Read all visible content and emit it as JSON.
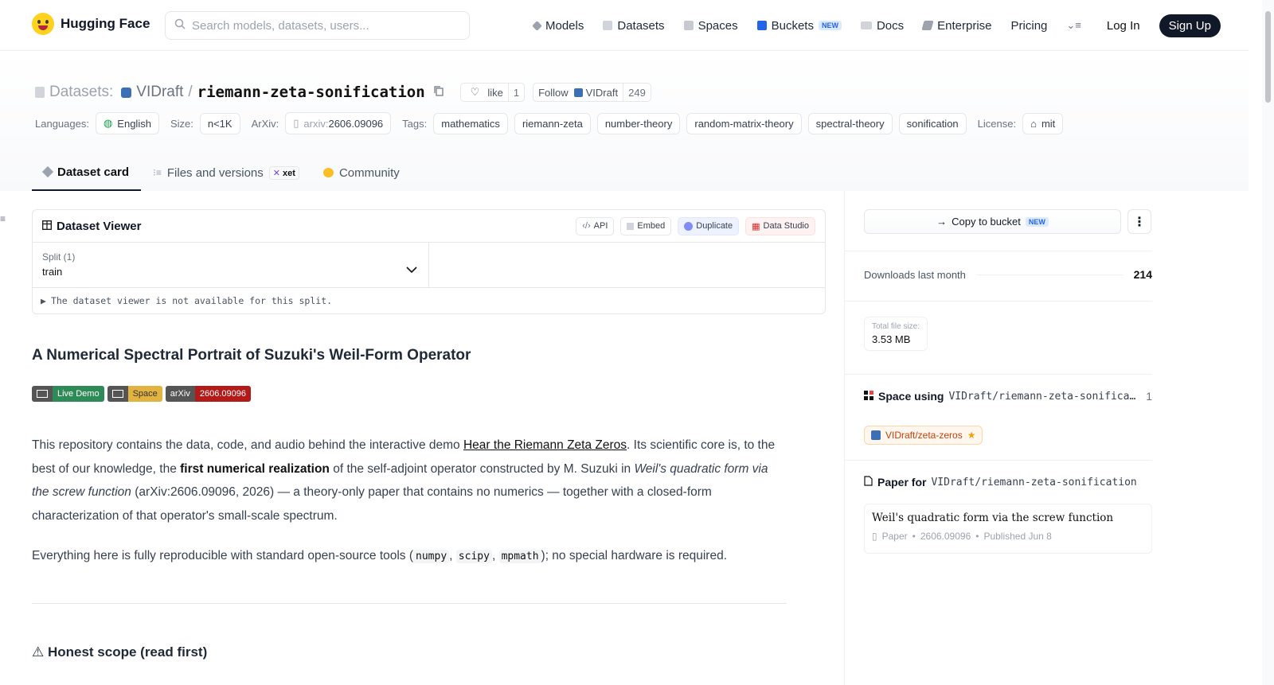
{
  "nav": {
    "brand": "Hugging Face",
    "search_placeholder": "Search models, datasets, users...",
    "links": [
      "Models",
      "Datasets",
      "Spaces",
      "Buckets",
      "Docs",
      "Enterprise",
      "Pricing"
    ],
    "new_badge": "NEW",
    "login": "Log In",
    "signup": "Sign Up"
  },
  "header": {
    "kind": "Datasets:",
    "namespace": "VIDraft",
    "separator": "/",
    "repo": "riemann-zeta-sonification",
    "like_label": "like",
    "like_count": "1",
    "follow_label": "Follow",
    "follow_org": "VIDraft",
    "follow_count": "249",
    "languages_label": "Languages:",
    "language": "English",
    "size_label": "Size:",
    "size": "n<1K",
    "arxiv_label": "ArXiv:",
    "arxiv_prefix": "arxiv:",
    "arxiv_id": "2606.09096",
    "tags_label": "Tags:",
    "tags": [
      "mathematics",
      "riemann-zeta",
      "number-theory",
      "random-matrix-theory",
      "spectral-theory",
      "sonification"
    ],
    "license_label": "License:",
    "license": "mit"
  },
  "tabs": {
    "card": "Dataset card",
    "files": "Files and versions",
    "xet": "xet",
    "community": "Community"
  },
  "viewer": {
    "title": "Dataset Viewer",
    "buttons": [
      "API",
      "Embed",
      "Duplicate",
      "Data Studio"
    ],
    "split_label": "Split (1)",
    "split_value": "train",
    "note": "The dataset viewer is not available for this split."
  },
  "card": {
    "title": "A Numerical Spectral Portrait of Suzuki's Weil-Form Operator",
    "badges": [
      {
        "left": "Live Demo",
        "right": ""
      },
      {
        "left": "Space",
        "right": ""
      },
      {
        "left": "arXiv",
        "right": "2606.09096"
      }
    ],
    "p1_a": "This repository contains the data, code, and audio behind the interactive demo ",
    "p1_link": "Hear the Riemann Zeta Zeros",
    "p1_b": ". Its scientific core is, to the best of our knowledge, the ",
    "p1_bold": "first numerical realization",
    "p1_c": " of the self-adjoint operator constructed by M. Suzuki in ",
    "p1_italic": "Weil's quadratic form via the screw function",
    "p1_d": " (arXiv:2606.09096, 2026) — a theory-only paper that contains no numerics — together with a closed-form characterization of that operator's small-scale spectrum.",
    "p2_a": "Everything here is fully reproducible with standard open-source tools (",
    "p2_code1": "numpy",
    "p2_sep1": ", ",
    "p2_code2": "scipy",
    "p2_sep2": ", ",
    "p2_code3": "mpmath",
    "p2_b": "); no special hardware is required.",
    "h3": "⚠ Honest scope (read first)"
  },
  "sidebar": {
    "copy_bucket": "Copy to bucket",
    "new_badge": "NEW",
    "downloads_label": "Downloads last month",
    "downloads": "214",
    "filesize_label": "Total file size:",
    "filesize": "3.53 MB",
    "space_using_label": "Space using",
    "space_using_repo": "VIDraft/riemann-zeta-sonification",
    "space_count": "1",
    "space_chip": "VIDraft/zeta-zeros",
    "paper_for_label": "Paper for",
    "paper_for_repo": "VIDraft/riemann-zeta-sonification",
    "paper_title": "Weil's quadratic form via the screw function",
    "paper_kind": "Paper",
    "paper_id": "2606.09096",
    "paper_date": "Published Jun 8"
  },
  "colors": {
    "live_demo": "#2e8b57",
    "space": "#e3b341",
    "arxiv": "#b31b1b"
  }
}
